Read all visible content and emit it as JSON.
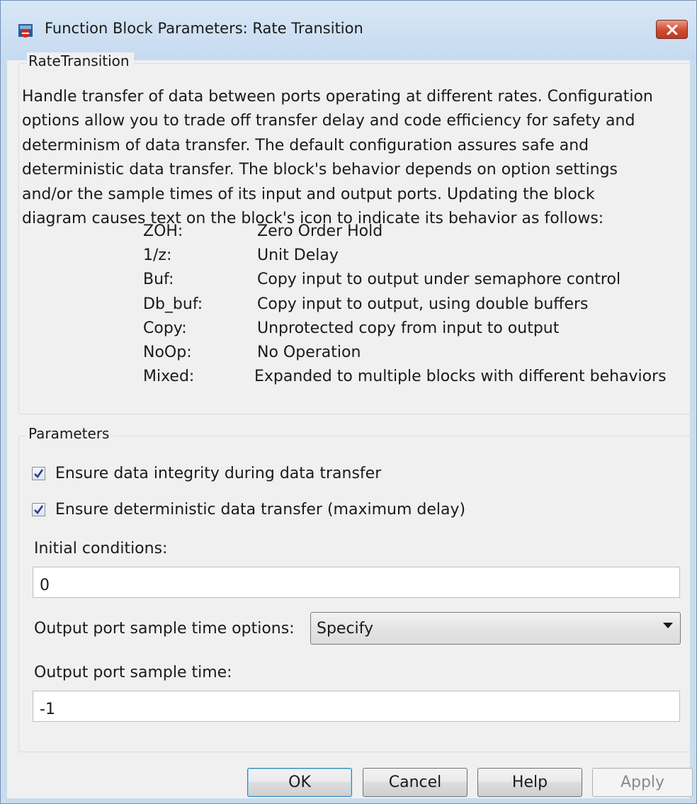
{
  "window": {
    "title": "Function Block Parameters: Rate Transition"
  },
  "block_group": {
    "legend": "RateTransition",
    "description_lines": [
      "Handle transfer of data between ports operating at different rates. Configuration",
      "options allow you to trade off transfer delay and code efficiency for safety and",
      "determinism of data transfer. The default configuration assures safe and",
      "deterministic data transfer. The block's behavior depends on option settings",
      "and/or the sample times of its input and output ports. Updating the block",
      "diagram causes text on the block's icon to indicate its behavior as follows:"
    ],
    "behaviors": [
      {
        "code": "ZOH:",
        "meaning": "Zero Order Hold"
      },
      {
        "code": "1/z:",
        "meaning": "Unit Delay"
      },
      {
        "code": "Buf:",
        "meaning": "Copy input to output under semaphore control"
      },
      {
        "code": "Db_buf:",
        "meaning": "Copy input to output, using double buffers"
      },
      {
        "code": "Copy:",
        "meaning": "Unprotected copy from input to output"
      },
      {
        "code": "NoOp:",
        "meaning": "No Operation"
      },
      {
        "code": "Mixed:",
        "meaning": "Expanded to multiple blocks with different behaviors"
      }
    ]
  },
  "parameters": {
    "legend": "Parameters",
    "ensure_integrity": {
      "label": "Ensure data integrity during data transfer",
      "checked": true
    },
    "ensure_deterministic": {
      "label": "Ensure deterministic data transfer (maximum delay)",
      "checked": true
    },
    "initial_conditions": {
      "label": "Initial conditions:",
      "value": "0"
    },
    "sample_time_options": {
      "label": "Output port sample time options:",
      "selected": "Specify"
    },
    "sample_time": {
      "label": "Output port sample time:",
      "value": "-1"
    }
  },
  "buttons": {
    "ok": "OK",
    "cancel": "Cancel",
    "help": "Help",
    "apply": "Apply"
  }
}
